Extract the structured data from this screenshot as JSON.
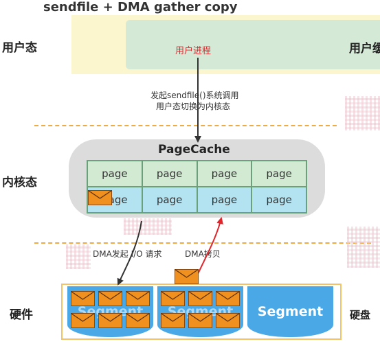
{
  "title": "sendfile + DMA gather copy",
  "layers": {
    "user": "用户态",
    "kernel": "内核态",
    "hardware": "硬件",
    "disk": "硬盘",
    "user_right": "用户缓"
  },
  "user_process": "用户进程",
  "syscall_note": {
    "line1": "发起sendfile()系统调用",
    "line2": "用户态切换为内核态"
  },
  "pagecache": {
    "title": "PageCache",
    "rows": [
      [
        "page",
        "page",
        "page",
        "page"
      ],
      [
        "page",
        "page",
        "page",
        "page"
      ]
    ]
  },
  "dma_io_note": "DMA发起 I/O 请求",
  "dma_copy_note": "DMA拷贝",
  "segments": [
    "Segment",
    "Segment",
    "Segment"
  ],
  "colors": {
    "user_band": "#fbf6cd",
    "user_process": "#d5ead6",
    "pagecache_bg": "#dcdcdc",
    "page_row1": "#d2ead2",
    "page_row2": "#b3e3f0",
    "segment": "#4aa8e6",
    "envelope": "#f0901e",
    "dashed_line": "#eeaa44",
    "hardware_border": "#f2c46a",
    "arrow_red": "#e0252b"
  }
}
